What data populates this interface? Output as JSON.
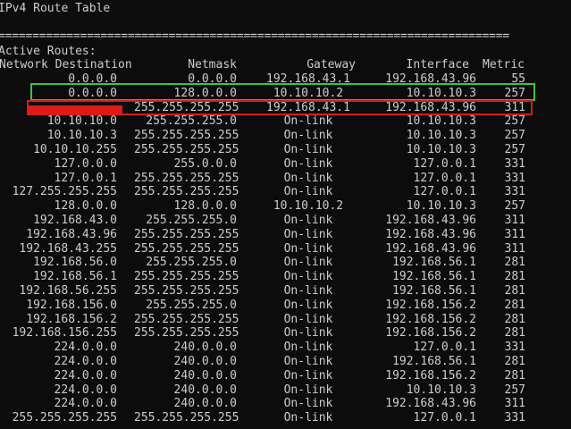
{
  "title": "IPv4 Route Table",
  "separator": "===========================================================================",
  "active_routes_label": "Active Routes:",
  "headers": {
    "dest": "Network Destination",
    "mask": "Netmask",
    "gw": "Gateway",
    "iface": "Interface",
    "metric": "Metric"
  },
  "highlight_colors": {
    "green": "#3cc43c",
    "red": "#d41c1c"
  },
  "rows": [
    {
      "dest": "0.0.0.0",
      "mask": "0.0.0.0",
      "gw": "192.168.43.1",
      "iface": "192.168.43.96",
      "metric": "55"
    },
    {
      "dest": "0.0.0.0",
      "mask": "128.0.0.0",
      "gw": "10.10.10.2",
      "iface": "10.10.10.3",
      "metric": "257"
    },
    {
      "dest": "",
      "mask": "255.255.255.255",
      "gw": "192.168.43.1",
      "iface": "192.168.43.96",
      "metric": "311"
    },
    {
      "dest": "10.10.10.0",
      "mask": "255.255.255.0",
      "gw": "On-link",
      "iface": "10.10.10.3",
      "metric": "257"
    },
    {
      "dest": "10.10.10.3",
      "mask": "255.255.255.255",
      "gw": "On-link",
      "iface": "10.10.10.3",
      "metric": "257"
    },
    {
      "dest": "10.10.10.255",
      "mask": "255.255.255.255",
      "gw": "On-link",
      "iface": "10.10.10.3",
      "metric": "257"
    },
    {
      "dest": "127.0.0.0",
      "mask": "255.0.0.0",
      "gw": "On-link",
      "iface": "127.0.0.1",
      "metric": "331"
    },
    {
      "dest": "127.0.0.1",
      "mask": "255.255.255.255",
      "gw": "On-link",
      "iface": "127.0.0.1",
      "metric": "331"
    },
    {
      "dest": "127.255.255.255",
      "mask": "255.255.255.255",
      "gw": "On-link",
      "iface": "127.0.0.1",
      "metric": "331"
    },
    {
      "dest": "128.0.0.0",
      "mask": "128.0.0.0",
      "gw": "10.10.10.2",
      "iface": "10.10.10.3",
      "metric": "257"
    },
    {
      "dest": "192.168.43.0",
      "mask": "255.255.255.0",
      "gw": "On-link",
      "iface": "192.168.43.96",
      "metric": "311"
    },
    {
      "dest": "192.168.43.96",
      "mask": "255.255.255.255",
      "gw": "On-link",
      "iface": "192.168.43.96",
      "metric": "311"
    },
    {
      "dest": "192.168.43.255",
      "mask": "255.255.255.255",
      "gw": "On-link",
      "iface": "192.168.43.96",
      "metric": "311"
    },
    {
      "dest": "192.168.56.0",
      "mask": "255.255.255.0",
      "gw": "On-link",
      "iface": "192.168.56.1",
      "metric": "281"
    },
    {
      "dest": "192.168.56.1",
      "mask": "255.255.255.255",
      "gw": "On-link",
      "iface": "192.168.56.1",
      "metric": "281"
    },
    {
      "dest": "192.168.56.255",
      "mask": "255.255.255.255",
      "gw": "On-link",
      "iface": "192.168.56.1",
      "metric": "281"
    },
    {
      "dest": "192.168.156.0",
      "mask": "255.255.255.0",
      "gw": "On-link",
      "iface": "192.168.156.2",
      "metric": "281"
    },
    {
      "dest": "192.168.156.2",
      "mask": "255.255.255.255",
      "gw": "On-link",
      "iface": "192.168.156.2",
      "metric": "281"
    },
    {
      "dest": "192.168.156.255",
      "mask": "255.255.255.255",
      "gw": "On-link",
      "iface": "192.168.156.2",
      "metric": "281"
    },
    {
      "dest": "224.0.0.0",
      "mask": "240.0.0.0",
      "gw": "On-link",
      "iface": "127.0.0.1",
      "metric": "331"
    },
    {
      "dest": "224.0.0.0",
      "mask": "240.0.0.0",
      "gw": "On-link",
      "iface": "192.168.56.1",
      "metric": "281"
    },
    {
      "dest": "224.0.0.0",
      "mask": "240.0.0.0",
      "gw": "On-link",
      "iface": "192.168.156.2",
      "metric": "281"
    },
    {
      "dest": "224.0.0.0",
      "mask": "240.0.0.0",
      "gw": "On-link",
      "iface": "10.10.10.3",
      "metric": "257"
    },
    {
      "dest": "224.0.0.0",
      "mask": "240.0.0.0",
      "gw": "On-link",
      "iface": "192.168.43.96",
      "metric": "311"
    },
    {
      "dest": "255.255.255.255",
      "mask": "255.255.255.255",
      "gw": "On-link",
      "iface": "127.0.0.1",
      "metric": "331"
    }
  ]
}
